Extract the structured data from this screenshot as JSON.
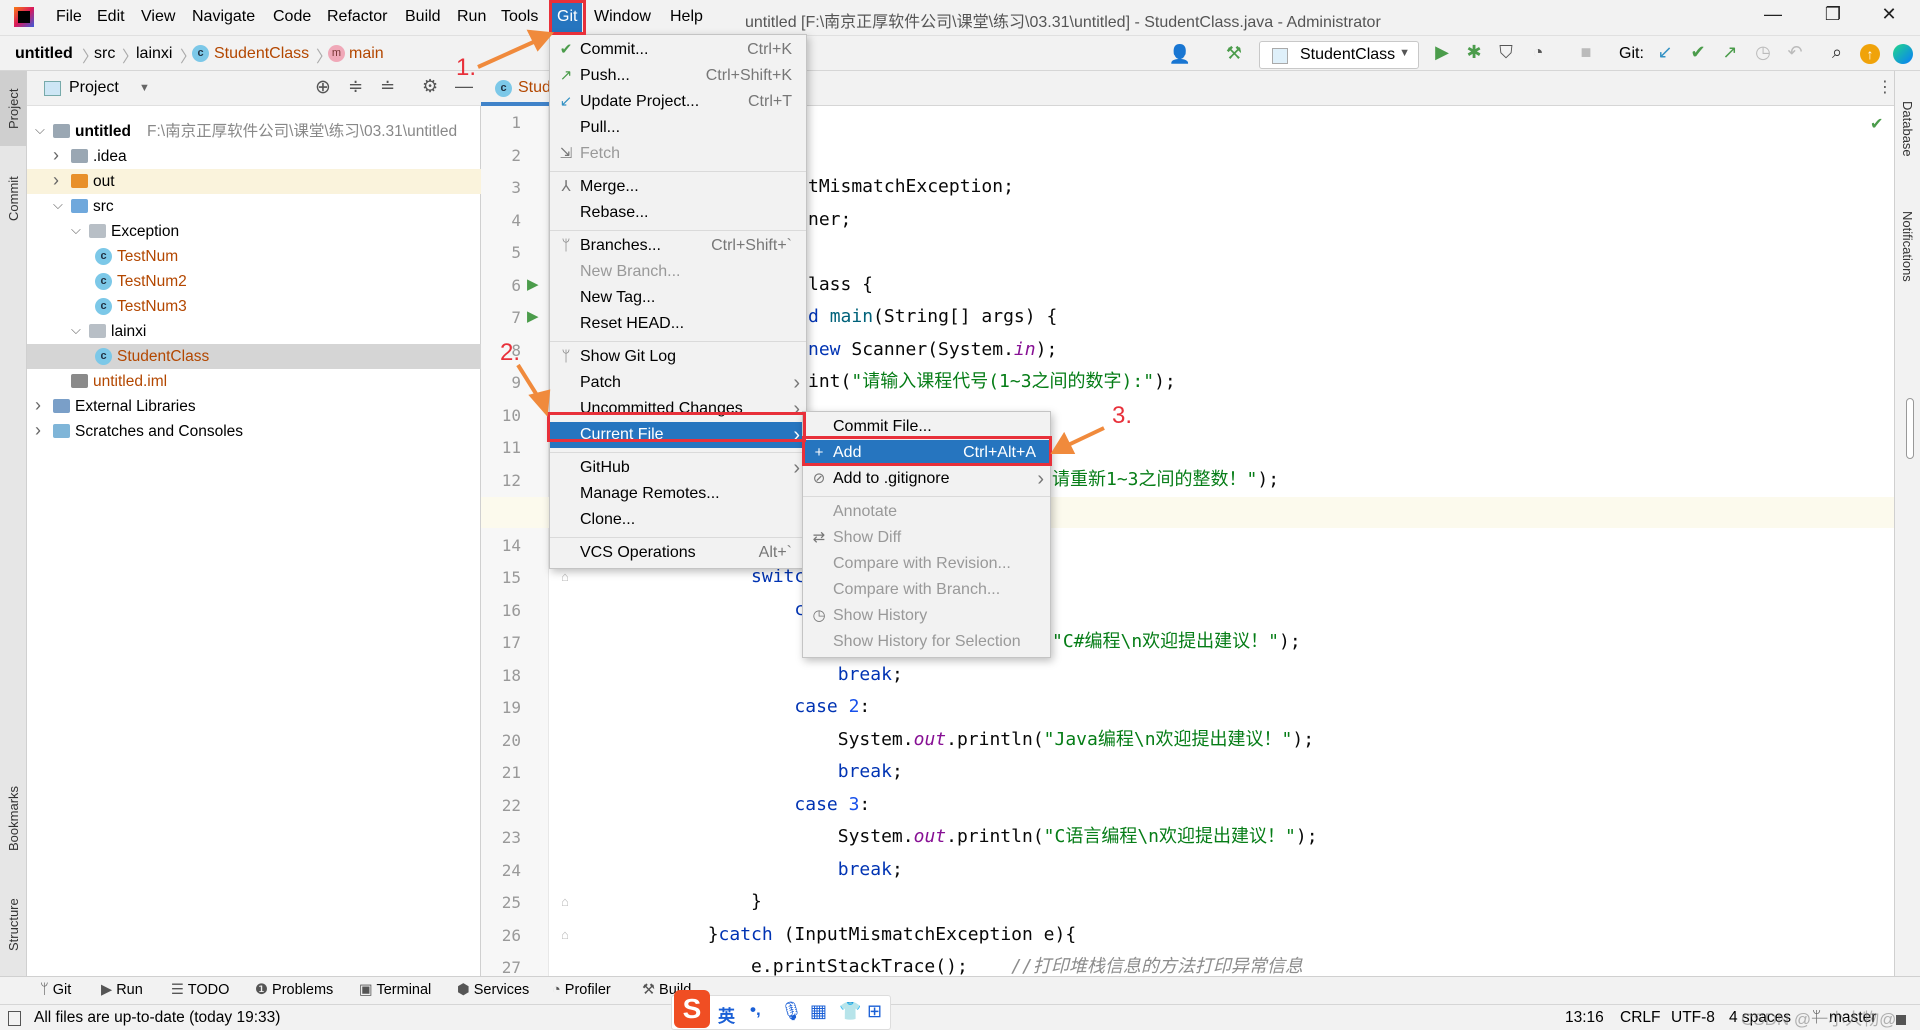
{
  "window": {
    "title": "untitled [F:\\南京正厚软件公司\\课堂\\练习\\03.31\\untitled] - StudentClass.java - Administrator",
    "minimize": "—",
    "maximize": "❐",
    "close": "✕"
  },
  "menubar": [
    "File",
    "Edit",
    "View",
    "Navigate",
    "Code",
    "Refactor",
    "Build",
    "Run",
    "Tools",
    "Git",
    "Window",
    "Help"
  ],
  "breadcrumb": {
    "project": "untitled",
    "src": "src",
    "package": "lainxi",
    "class": "StudentClass",
    "method": "main"
  },
  "toolbar": {
    "run_config": "StudentClass",
    "git_label": "Git:"
  },
  "project_panel": {
    "title": "Project",
    "tree": [
      {
        "label": "untitled",
        "path": "F:\\南京正厚软件公司\\课堂\\练习\\03.31\\untitled",
        "depth": 0,
        "expanded": true,
        "icon": "module-folder-icon"
      },
      {
        "label": ".idea",
        "depth": 1,
        "expanded": false,
        "icon": "folder-icon"
      },
      {
        "label": "out",
        "depth": 1,
        "expanded": false,
        "icon": "excluded-folder-icon",
        "excluded": true
      },
      {
        "label": "src",
        "depth": 1,
        "expanded": true,
        "icon": "source-folder-icon"
      },
      {
        "label": "Exception",
        "depth": 2,
        "expanded": true,
        "icon": "package-icon"
      },
      {
        "label": "TestNum",
        "depth": 3,
        "icon": "java-class-icon",
        "color": "#b34700"
      },
      {
        "label": "TestNum2",
        "depth": 3,
        "icon": "java-class-icon",
        "color": "#b34700"
      },
      {
        "label": "TestNum3",
        "depth": 3,
        "icon": "java-class-icon",
        "color": "#b34700"
      },
      {
        "label": "lainxi",
        "depth": 2,
        "expanded": true,
        "icon": "package-icon"
      },
      {
        "label": "StudentClass",
        "depth": 3,
        "icon": "java-class-icon",
        "color": "#b34700",
        "selected": true
      },
      {
        "label": "untitled.iml",
        "depth": 1,
        "icon": "iml-file-icon",
        "color": "#b34700"
      },
      {
        "label": "External Libraries",
        "depth": 0,
        "expanded": false,
        "icon": "libraries-icon"
      },
      {
        "label": "Scratches and Consoles",
        "depth": 0,
        "expanded": false,
        "icon": "scratches-icon"
      }
    ]
  },
  "editor": {
    "tab": "Stud",
    "lines": [
      {
        "n": 1,
        "segs": []
      },
      {
        "n": 2,
        "segs": []
      },
      {
        "n": 3,
        "clip": "menu",
        "segs": [
          [
            "tMismatchException;",
            ""
          ]
        ]
      },
      {
        "n": 4,
        "clip": "menu",
        "segs": [
          [
            "ner;",
            ""
          ]
        ]
      },
      {
        "n": 5,
        "segs": []
      },
      {
        "n": 6,
        "clip": "menu",
        "run": true,
        "segs": [
          [
            "lass {",
            ""
          ]
        ]
      },
      {
        "n": 7,
        "clip": "menu",
        "run": true,
        "segs": [
          [
            "d ",
            "k"
          ],
          [
            "main",
            "m"
          ],
          [
            "(String[] args) {",
            ""
          ]
        ]
      },
      {
        "n": 8,
        "clip": "menu",
        "segs": [
          [
            "new ",
            "k"
          ],
          [
            "Scanner(System.",
            ""
          ],
          [
            "in",
            "f"
          ],
          [
            ");",
            ""
          ]
        ]
      },
      {
        "n": 9,
        "clip": "menu",
        "segs": [
          [
            "int(",
            ""
          ],
          [
            "\"请输入课程代号(1~3之间的数字):\"",
            "s"
          ],
          [
            ");",
            ""
          ]
        ]
      },
      {
        "n": 10,
        "segs": []
      },
      {
        "n": 11,
        "segs": []
      },
      {
        "n": 12,
        "clip": "submenu",
        "segs": [
          [
            "请重新1~3之间的整数！\"",
            "s"
          ],
          [
            ");",
            ""
          ]
        ]
      },
      {
        "n": 13,
        "segs": []
      },
      {
        "n": 14,
        "segs": []
      },
      {
        "n": 15,
        "segs": [
          [
            "            ",
            ""
          ],
          [
            "switc",
            "k"
          ]
        ]
      },
      {
        "n": 16,
        "segs": [
          [
            "                ",
            ""
          ],
          [
            "c",
            "k"
          ]
        ]
      },
      {
        "n": 17,
        "clip": "submenu",
        "segs": [
          [
            "\"C#编程\\n欢迎提出建议！\"",
            "s"
          ],
          [
            ");",
            ""
          ]
        ]
      },
      {
        "n": 18,
        "segs": [
          [
            "                    ",
            ""
          ],
          [
            "break",
            "k"
          ],
          [
            ";",
            ""
          ]
        ]
      },
      {
        "n": 19,
        "segs": [
          [
            "                ",
            ""
          ],
          [
            "case ",
            "k"
          ],
          [
            "2",
            "n"
          ],
          [
            ":",
            ""
          ]
        ]
      },
      {
        "n": 20,
        "segs": [
          [
            "                    System.",
            ""
          ],
          [
            "out",
            "f"
          ],
          [
            ".println(",
            ""
          ],
          [
            "\"Java编程\\n欢迎提出建议！\"",
            "s"
          ],
          [
            ");",
            ""
          ]
        ]
      },
      {
        "n": 21,
        "segs": [
          [
            "                    ",
            ""
          ],
          [
            "break",
            "k"
          ],
          [
            ";",
            ""
          ]
        ]
      },
      {
        "n": 22,
        "segs": [
          [
            "                ",
            ""
          ],
          [
            "case ",
            "k"
          ],
          [
            "3",
            "n"
          ],
          [
            ":",
            ""
          ]
        ]
      },
      {
        "n": 23,
        "segs": [
          [
            "                    System.",
            ""
          ],
          [
            "out",
            "f"
          ],
          [
            ".println(",
            ""
          ],
          [
            "\"C语言编程\\n欢迎提出建议！\"",
            "s"
          ],
          [
            ");",
            ""
          ]
        ]
      },
      {
        "n": 24,
        "segs": [
          [
            "                    ",
            ""
          ],
          [
            "break",
            "k"
          ],
          [
            ";",
            ""
          ]
        ]
      },
      {
        "n": 25,
        "segs": [
          [
            "            }",
            ""
          ]
        ]
      },
      {
        "n": 26,
        "segs": [
          [
            "        }",
            ""
          ],
          [
            "catch ",
            "k"
          ],
          [
            "(InputMismatchException e){",
            ""
          ]
        ]
      },
      {
        "n": 27,
        "segs": [
          [
            "            e.printStackTrace();    ",
            ""
          ],
          [
            "//打印堆栈信息的方法打印异常信息",
            "c"
          ]
        ]
      }
    ],
    "current_line": 13
  },
  "git_menu": [
    {
      "label": "Commit...",
      "shortcut": "Ctrl+K",
      "icon": "check-icon",
      "icon_color": "#4b9c4b"
    },
    {
      "label": "Push...",
      "shortcut": "Ctrl+Shift+K",
      "icon": "push-arrow-icon",
      "icon_color": "#4b9c4b"
    },
    {
      "label": "Update Project...",
      "shortcut": "Ctrl+T",
      "icon": "update-arrow-icon",
      "icon_color": "#3592c4"
    },
    {
      "label": "Pull..."
    },
    {
      "label": "Fetch",
      "disabled": true,
      "icon": "fetch-icon"
    },
    {
      "sep": true
    },
    {
      "label": "Merge...",
      "icon": "merge-icon"
    },
    {
      "label": "Rebase..."
    },
    {
      "sep": true
    },
    {
      "label": "Branches...",
      "shortcut": "Ctrl+Shift+`",
      "icon": "branch-icon"
    },
    {
      "label": "New Branch...",
      "disabled": true
    },
    {
      "label": "New Tag..."
    },
    {
      "label": "Reset HEAD..."
    },
    {
      "sep": true
    },
    {
      "label": "Show Git Log",
      "icon": "branch-icon"
    },
    {
      "label": "Patch",
      "submenu": true
    },
    {
      "label": "Uncommitted Changes",
      "submenu": true
    },
    {
      "label": "Current File",
      "submenu": true,
      "highlighted": true
    },
    {
      "sep": true
    },
    {
      "label": "GitHub",
      "submenu": true
    },
    {
      "label": "Manage Remotes..."
    },
    {
      "label": "Clone..."
    },
    {
      "sep": true
    },
    {
      "label": "VCS Operations",
      "shortcut": "Alt+`"
    }
  ],
  "current_file_menu": [
    {
      "label": "Commit File..."
    },
    {
      "label": "Add",
      "shortcut": "Ctrl+Alt+A",
      "icon": "plus-icon",
      "highlighted": true
    },
    {
      "label": "Add to .gitignore",
      "submenu": true,
      "icon": "gitignore-icon"
    },
    {
      "sep": true
    },
    {
      "label": "Annotate",
      "disabled": true
    },
    {
      "label": "Show Diff",
      "disabled": true,
      "icon": "diff-icon"
    },
    {
      "label": "Compare with Revision...",
      "disabled": true
    },
    {
      "label": "Compare with Branch...",
      "disabled": true
    },
    {
      "label": "Show History",
      "disabled": true,
      "icon": "clock-icon"
    },
    {
      "label": "Show History for Selection",
      "disabled": true
    }
  ],
  "annotations": {
    "step1": "1.",
    "step2": "2.",
    "step3": "3.",
    "color": "#e8303a",
    "arrow_color": "#f08a3c"
  },
  "left_strip": [
    "Project",
    "Commit",
    "Bookmarks",
    "Structure"
  ],
  "right_strip": [
    "Database",
    "Notifications"
  ],
  "tool_windows": [
    {
      "label": "Git",
      "icon": "git-branch-icon"
    },
    {
      "label": "Run",
      "icon": "play-icon"
    },
    {
      "label": "TODO",
      "icon": "list-icon"
    },
    {
      "label": "Problems",
      "icon": "warning-icon"
    },
    {
      "label": "Terminal",
      "icon": "terminal-icon"
    },
    {
      "label": "Services",
      "icon": "services-icon"
    },
    {
      "label": "Profiler",
      "icon": "profiler-icon"
    },
    {
      "label": "Build",
      "icon": "hammer-icon"
    }
  ],
  "status": {
    "message": "All files are up-to-date (today 19:33)",
    "position": "13:16",
    "line_sep": "CRLF",
    "encoding": "UTF-8",
    "indent": "4 spaces",
    "branch": "master",
    "watermark": "CSDN @一小人物@"
  },
  "ime": {
    "lang": "英",
    "punct": "•,"
  },
  "colors": {
    "accent": "#2675bf",
    "highlight_box": "#e8303a",
    "arrow": "#f08a3c"
  }
}
